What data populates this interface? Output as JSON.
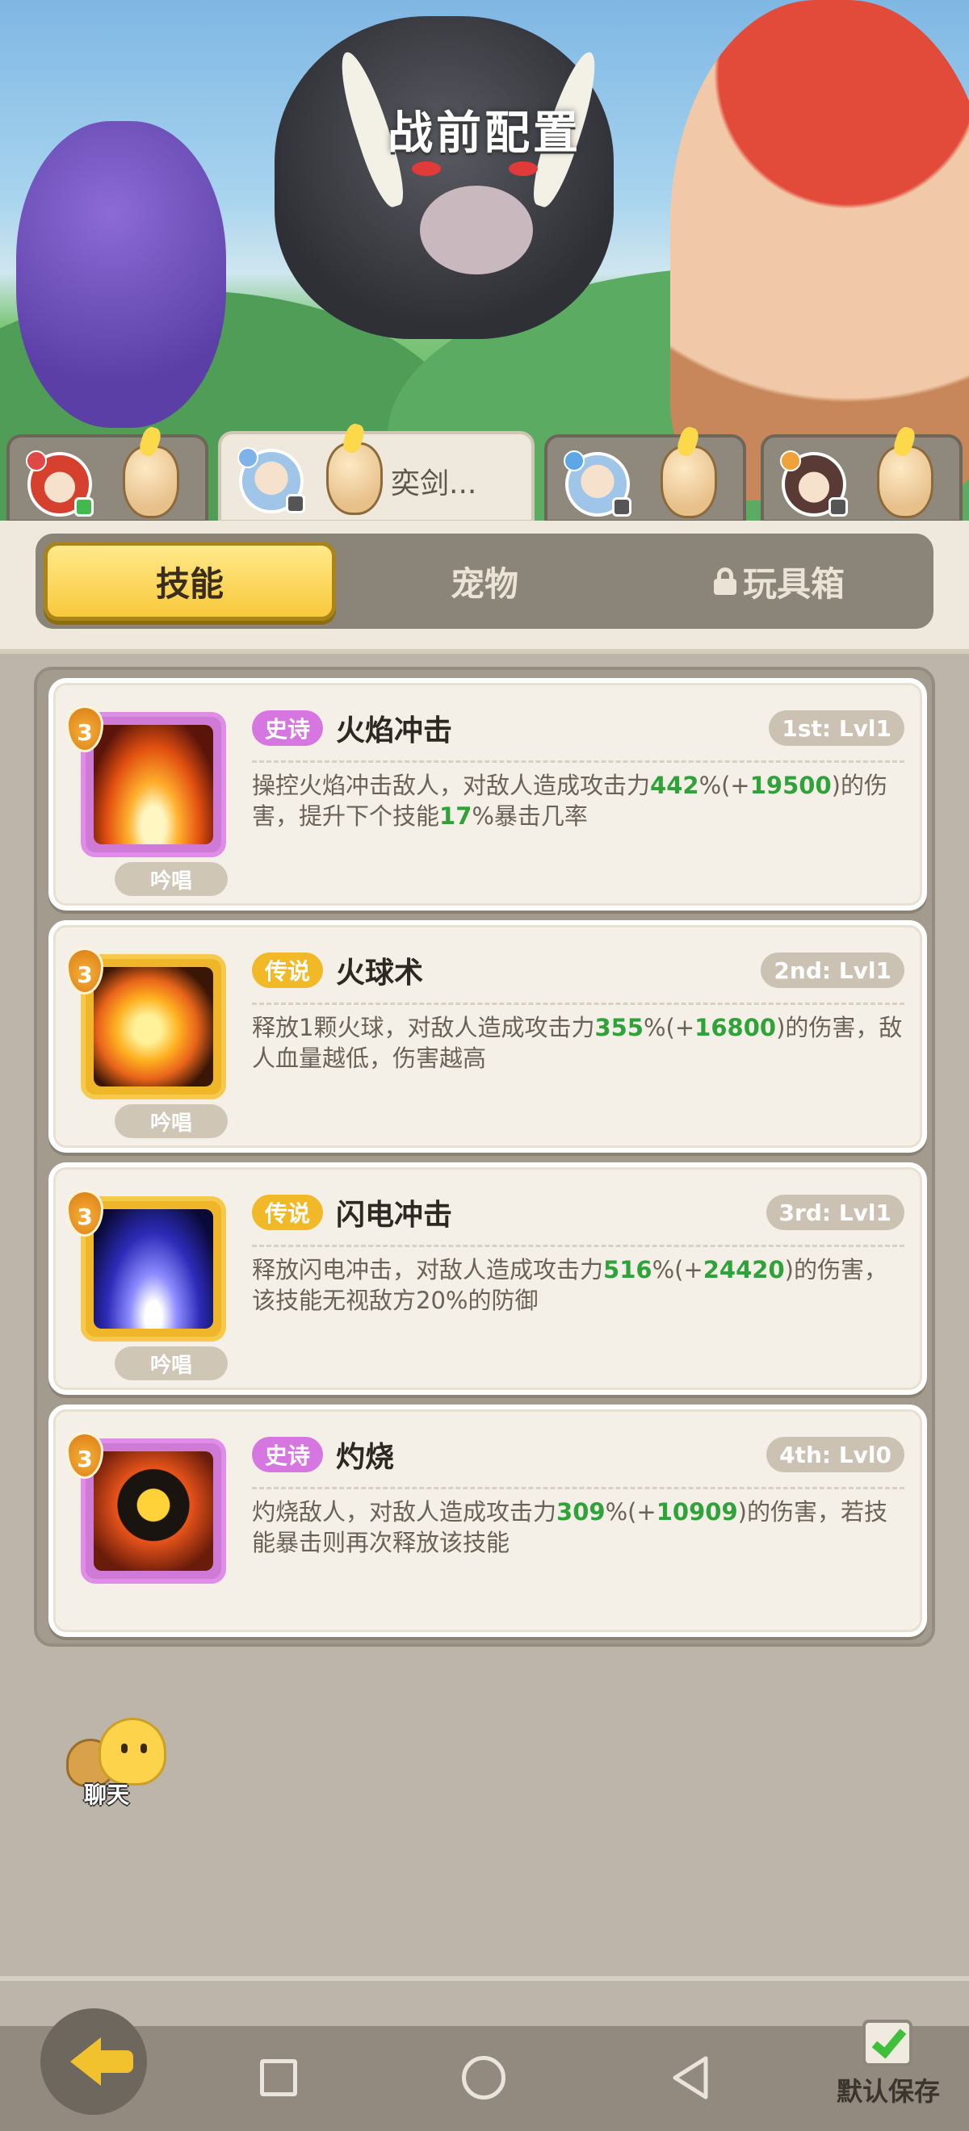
{
  "header": {
    "title": "战前配置"
  },
  "heroes": [
    {
      "name": ""
    },
    {
      "name": "奕剑..."
    },
    {
      "name": ""
    },
    {
      "name": ""
    }
  ],
  "tabs": {
    "skills": "技能",
    "pets": "宠物",
    "toybox": "玩具箱"
  },
  "skills": [
    {
      "level_badge": "3",
      "rarity": "史诗",
      "name": "火焰冲击",
      "slot_level": "1st: Lvl1",
      "chant": "吟唱",
      "desc_a": "操控火焰冲击敌人，对敌人造成攻击力",
      "val_1": "442",
      "desc_b": "%(+",
      "val_2": "19500",
      "desc_c": ")的伤害，提升下个技能",
      "val_3": "17",
      "desc_d": "%暴击几率"
    },
    {
      "level_badge": "3",
      "rarity": "传说",
      "name": "火球术",
      "slot_level": "2nd: Lvl1",
      "chant": "吟唱",
      "desc_a": "释放1颗火球，对敌人造成攻击力",
      "val_1": "355",
      "desc_b": "%(+",
      "val_2": "16800",
      "desc_c": ")的伤害，敌人血量越低，伤害越高"
    },
    {
      "level_badge": "3",
      "rarity": "传说",
      "name": "闪电冲击",
      "slot_level": "3rd: Lvl1",
      "chant": "吟唱",
      "desc_a": "释放闪电冲击，对敌人造成攻击力",
      "val_1": "516",
      "desc_b": "%(+",
      "val_2": "24420",
      "desc_c": ")的伤害，该技能无视敌方20%的防御"
    },
    {
      "level_badge": "3",
      "rarity": "史诗",
      "name": "灼烧",
      "slot_level": "4th: Lvl0",
      "desc_a": "灼烧敌人，对敌人造成攻击力",
      "val_1": "309",
      "desc_b": "%(+",
      "val_2": "10909",
      "desc_c": ")的伤害，若技能暴击则再次释放该技能"
    }
  ],
  "chat": {
    "label": "聊天"
  },
  "footer": {
    "save_label": "默认保存"
  },
  "colors": {
    "accent": "#f8c93b",
    "epic": "#d676e0",
    "legend": "#f1b928",
    "value_green": "#2fa23a"
  }
}
